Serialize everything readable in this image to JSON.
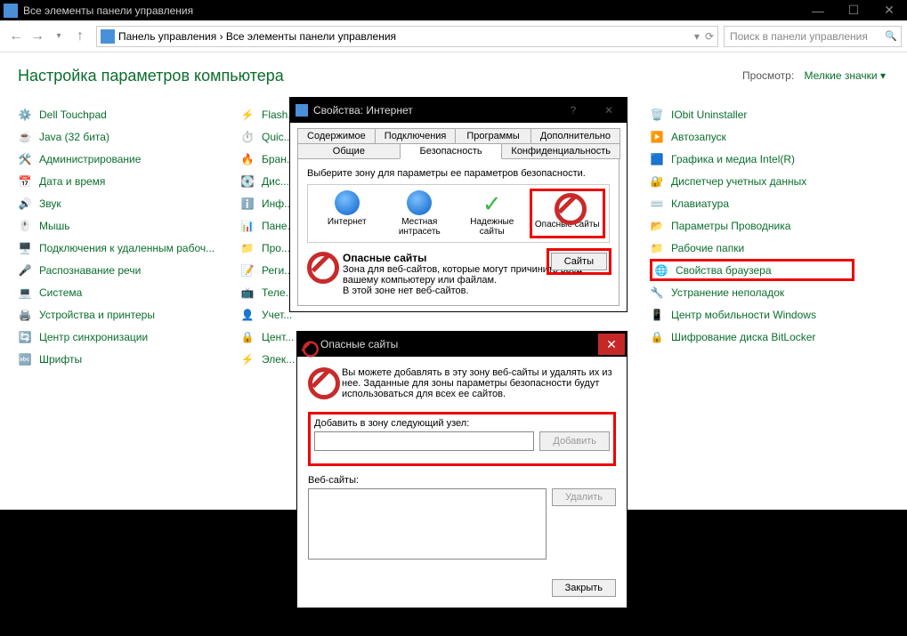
{
  "window": {
    "title": "Все элементы панели управления",
    "breadcrumb_root": "Панель управления",
    "breadcrumb_leaf": "Все элементы панели управления"
  },
  "search": {
    "placeholder": "Поиск в панели управления"
  },
  "heading": "Настройка параметров компьютера",
  "view": {
    "label": "Просмотр:",
    "mode": "Мелкие значки"
  },
  "columns": [
    [
      "Dell Touchpad",
      "Java (32 бита)",
      "Администрирование",
      "Дата и время",
      "Звук",
      "Мышь",
      "Подключения к удаленным рабоч...",
      "Распознавание речи",
      "Система",
      "Устройства и принтеры",
      "Центр синхронизации",
      "Шрифты"
    ],
    [
      "Flash...",
      "Quic...",
      "Бран...",
      "Дис...",
      "Инф...",
      "Пане...",
      "Про...",
      "Реги...",
      "Теле...",
      "Учет...",
      "Цент...",
      "Элек..."
    ],
    [
      "IObit Uninstaller",
      "Автозапуск",
      "Графика и медиа Intel(R)",
      "Диспетчер учетных данных",
      "Клавиатура",
      "Параметры Проводника",
      "Рабочие папки",
      "Свойства браузера",
      "Устранение неполадок",
      "Центр мобильности Windows",
      "Шифрование диска BitLocker"
    ]
  ],
  "dlg1": {
    "title": "Свойства: Интернет",
    "tabs_row1": [
      "Содержимое",
      "Подключения",
      "Программы",
      "Дополнительно"
    ],
    "tabs_row2": [
      "Общие",
      "Безопасность",
      "Конфиденциальность"
    ],
    "active_tab": "Безопасность",
    "zone_prompt": "Выберите зону для параметры ее параметров безопасности.",
    "zones": [
      "Интернет",
      "Местная интрасеть",
      "Надежные сайты",
      "Опасные сайты"
    ],
    "selected_zone": "Опасные сайты",
    "zone_title": "Опасные сайты",
    "zone_desc": "Зона для веб-сайтов, которые могут причинить вред вашему компьютеру или файлам.\nВ этой зоне нет веб-сайтов.",
    "sites_button": "Сайты"
  },
  "dlg2": {
    "title": "Опасные сайты",
    "intro": "Вы можете добавлять в эту зону веб-сайты и удалять их из нее. Заданные для зоны параметры безопасности будут использоваться для всех ее сайтов.",
    "add_label": "Добавить в зону следующий узел:",
    "add_value": "",
    "add_button": "Добавить",
    "list_label": "Веб-сайты:",
    "remove_button": "Удалить",
    "close_button": "Закрыть"
  },
  "colors": {
    "accent_red": "#e00",
    "link": "#0a6e2c"
  }
}
